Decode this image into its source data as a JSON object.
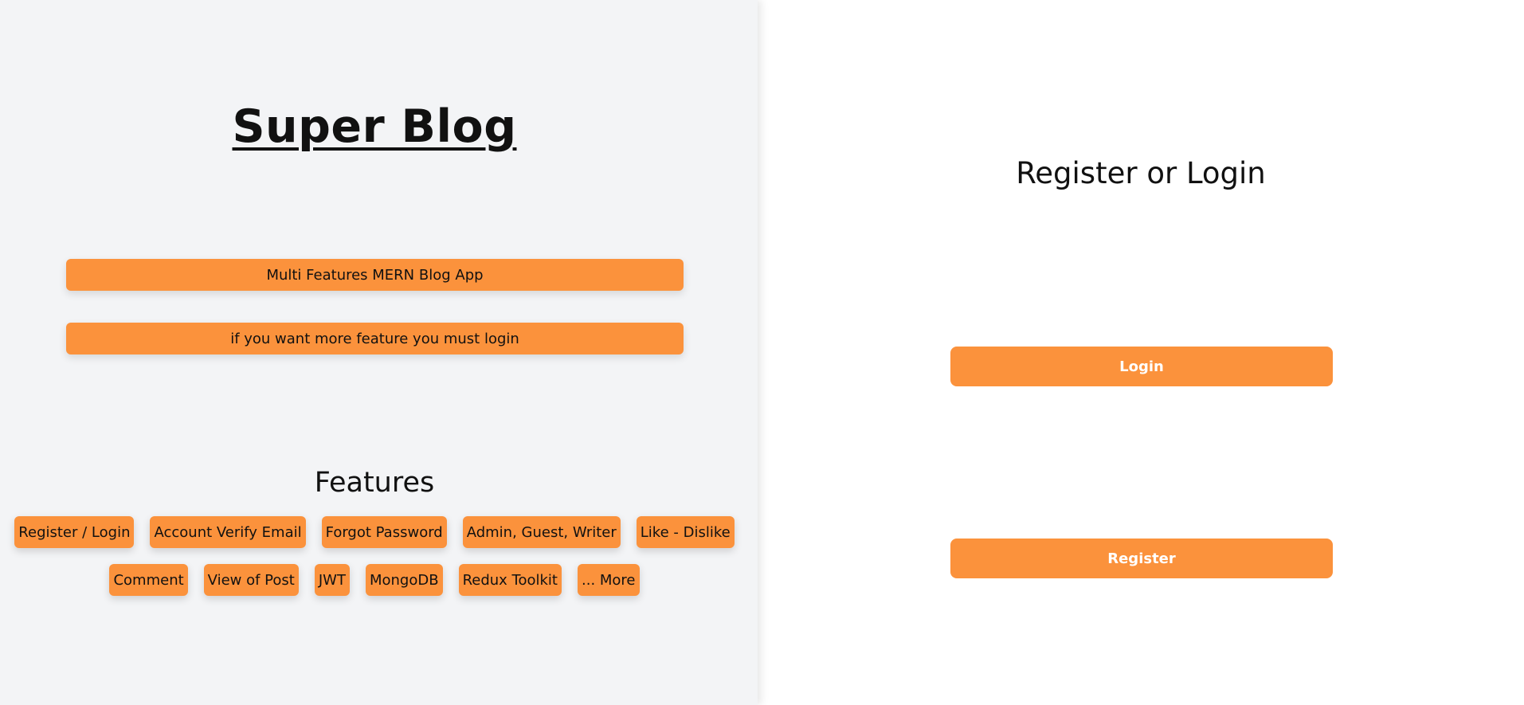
{
  "left": {
    "title": "Super Blog",
    "banners": [
      "Multi Features MERN Blog App",
      "if you want more feature you must login"
    ],
    "features_heading": "Features",
    "features_row_1": [
      "Register / Login",
      "Account Verify Email",
      "Forgot Password",
      "Admin, Guest, Writer",
      "Like - Dislike"
    ],
    "features_row_2": [
      "Comment",
      "View of Post",
      "JWT",
      "MongoDB",
      "Redux Toolkit",
      "... More"
    ]
  },
  "right": {
    "heading": "Register or Login",
    "login_label": "Login",
    "register_label": "Register"
  },
  "colors": {
    "accent": "#fb923c",
    "left_background": "#f3f4f6",
    "right_background": "#ffffff"
  }
}
